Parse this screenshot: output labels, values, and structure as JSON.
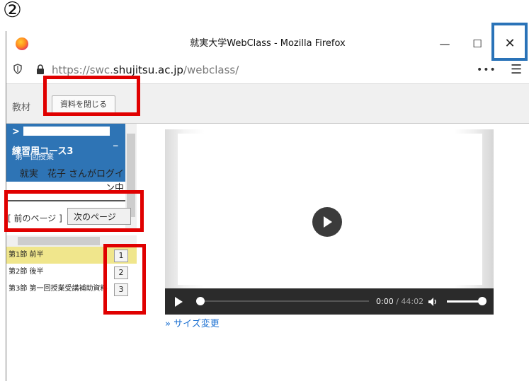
{
  "step_marker": "②",
  "window": {
    "title": "就実大学WebClass - Mozilla Firefox",
    "minimize": "—",
    "maximize": "☐",
    "close": "✕"
  },
  "urlbar": {
    "url_prefix": "https://swc.",
    "url_domain": "shujitsu.ac.jp",
    "url_path": "/webclass/",
    "menu_dots": "•••",
    "menu_icon": "☰"
  },
  "toolbar": {
    "tab_label": "教材",
    "close_material_label": "資料を閉じる"
  },
  "sidebar": {
    "course_title": "> 　　　　　　　　　　　_練習用コース3",
    "lesson_title": "第一回授業",
    "login_status": "就実　花子 さんがログイン中",
    "prev_page": "[ 前のページ ]",
    "next_page": "次のページ",
    "sections": [
      {
        "label": "第1節 前半",
        "page": "1",
        "highlighted": true
      },
      {
        "label": "第2節 後半",
        "page": "2",
        "highlighted": false
      },
      {
        "label": "第3節 第一回授業受講補助資料",
        "page": "3",
        "highlighted": false
      }
    ]
  },
  "video": {
    "current_time": "0:00",
    "separator": " / ",
    "duration": "44:02",
    "resize_link": "» サイズ変更"
  },
  "colors": {
    "course_header": "#2e74b5",
    "highlight": "#f0e68c",
    "annotation_red": "#e00000",
    "annotation_blue": "#2a73b8"
  }
}
